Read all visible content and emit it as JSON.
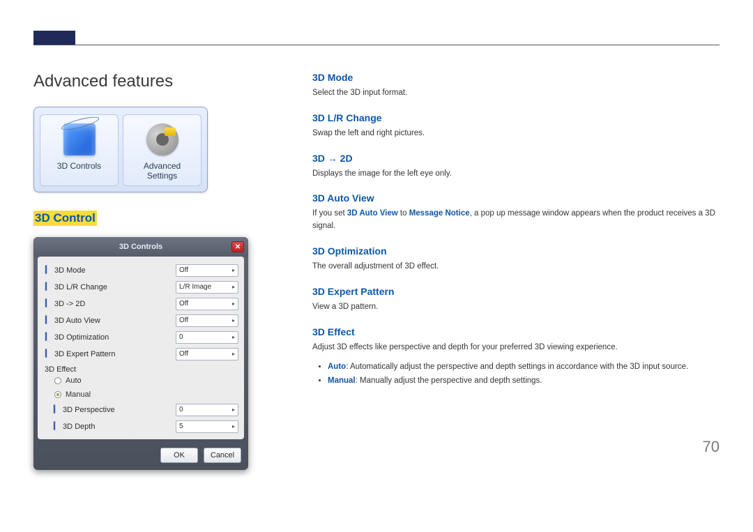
{
  "page_number": "70",
  "left": {
    "title": "Advanced features",
    "thumbs": [
      {
        "id": "3d-controls",
        "label": "3D Controls"
      },
      {
        "id": "advanced-settings",
        "label": "Advanced\nSettings"
      }
    ],
    "section_title": "3D Control",
    "dialog": {
      "title": "3D Controls",
      "rows": [
        {
          "label": "3D Mode",
          "value": "Off"
        },
        {
          "label": "3D L/R Change",
          "value": "L/R Image"
        },
        {
          "label": "3D -> 2D",
          "value": "Off"
        },
        {
          "label": "3D Auto View",
          "value": "Off"
        },
        {
          "label": "3D Optimization",
          "value": "0"
        },
        {
          "label": "3D Expert Pattern",
          "value": "Off"
        }
      ],
      "effect_group_label": "3D Effect",
      "radios": {
        "auto": "Auto",
        "manual": "Manual",
        "selected": "manual"
      },
      "subrows": [
        {
          "label": "3D Perspective",
          "value": "0"
        },
        {
          "label": "3D Depth",
          "value": "5"
        }
      ],
      "ok": "OK",
      "cancel": "Cancel"
    }
  },
  "right": {
    "blocks": [
      {
        "title": "3D Mode",
        "body": "Select the 3D input format."
      },
      {
        "title": "3D L/R Change",
        "body": "Swap the left and right pictures."
      },
      {
        "title": "3D → 2D",
        "body": "Displays the image for the left eye only."
      },
      {
        "title": "3D Auto View",
        "body_pre": "If you set ",
        "bold1": "3D Auto View",
        "mid": " to ",
        "bold2": "Message Notice",
        "body_post": ", a pop up message window appears when the product receives a 3D signal."
      },
      {
        "title": "3D Optimization",
        "body": "The overall adjustment of 3D effect."
      },
      {
        "title": "3D Expert Pattern",
        "body": "View a 3D pattern."
      },
      {
        "title": "3D Effect",
        "body": "Adjust 3D effects like perspective and depth for your preferred 3D viewing experience."
      }
    ],
    "bullets": [
      {
        "bold": "Auto",
        "text": ": Automatically adjust the perspective and depth settings in accordance with the 3D input source."
      },
      {
        "bold": "Manual",
        "text": ": Manually adjust the perspective and depth settings."
      }
    ]
  }
}
